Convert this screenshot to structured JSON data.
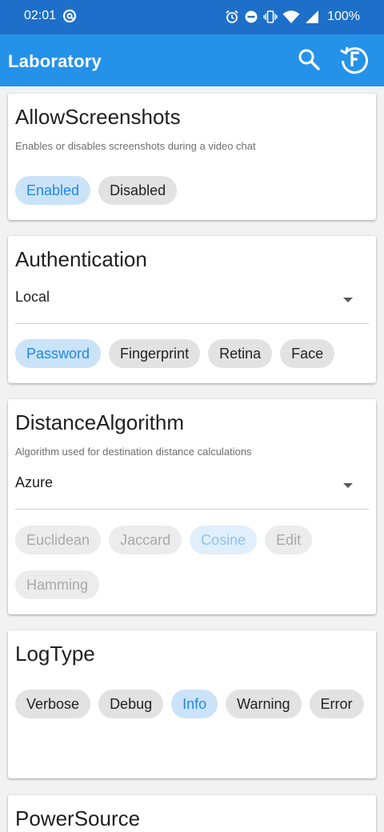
{
  "status_bar": {
    "time": "02:01",
    "battery": "100%",
    "icons": [
      "at-sign-icon",
      "alarm-icon",
      "do-not-disturb-icon",
      "vibrate-icon",
      "wifi-icon",
      "signal-icon"
    ]
  },
  "app_bar": {
    "title": "Laboratory",
    "actions": [
      "search-icon",
      "reset-icon"
    ],
    "color": "#2592e9",
    "status_color": "#1e6fc9"
  },
  "cards": {
    "allow_screenshots": {
      "title": "AllowScreenshots",
      "description": "Enables or disables screenshots during a video chat",
      "options": [
        "Enabled",
        "Disabled"
      ],
      "selected": "Enabled"
    },
    "authentication": {
      "title": "Authentication",
      "dropdown_value": "Local",
      "options": [
        "Password",
        "Fingerprint",
        "Retina",
        "Face"
      ],
      "selected": "Password"
    },
    "distance_algorithm": {
      "title": "DistanceAlgorithm",
      "description": "Algorithm used for destination distance calculations",
      "dropdown_value": "Azure",
      "options": [
        "Euclidean",
        "Jaccard",
        "Cosine",
        "Edit",
        "Hamming"
      ],
      "selected": "Cosine",
      "options_disabled": true
    },
    "log_type": {
      "title": "LogType",
      "options": [
        "Verbose",
        "Debug",
        "Info",
        "Warning",
        "Error"
      ],
      "selected": "Info"
    },
    "power_source": {
      "title": "PowerSource"
    }
  },
  "colors": {
    "chip_selected_text": "#1e88e5",
    "chip_selected_bg": "#cbe3f8",
    "chip_bg": "#e2e2e2"
  }
}
